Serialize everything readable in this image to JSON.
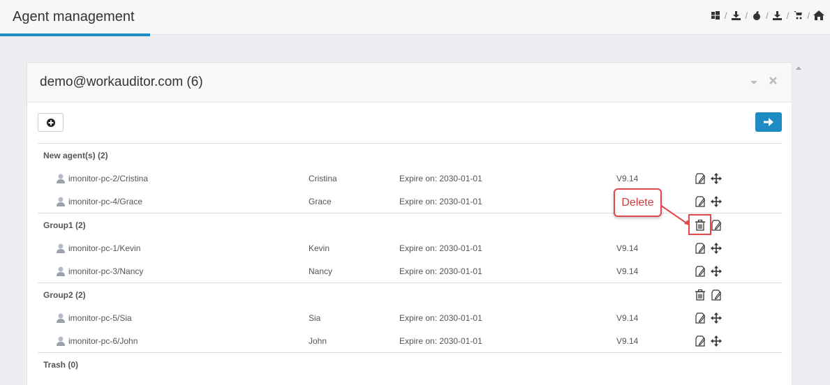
{
  "header": {
    "title": "Agent management",
    "nav": [
      {
        "icon": "windows-icon"
      },
      {
        "icon": "download-icon"
      },
      {
        "icon": "apple-icon"
      },
      {
        "icon": "download-icon"
      },
      {
        "icon": "cart-icon"
      },
      {
        "icon": "home-icon"
      }
    ],
    "separator": "/"
  },
  "panel": {
    "title": "demo@workauditor.com (6)",
    "collapse_icon": "caret-down-icon",
    "close_icon": "close-icon"
  },
  "toolbar": {
    "add_icon": "plus-circle-icon",
    "go_icon": "arrow-right-icon"
  },
  "groups": [
    {
      "label": "New agent(s) (2)",
      "agents": [
        {
          "name": "imonitor-pc-2/Cristina",
          "user": "Cristina",
          "expire": "Expire on: 2030-01-01",
          "version": "V9.14"
        },
        {
          "name": "imonitor-pc-4/Grace",
          "user": "Grace",
          "expire": "Expire on: 2030-01-01",
          "version": ""
        }
      ]
    },
    {
      "label": "Group1 (2)",
      "agents": [
        {
          "name": "imonitor-pc-1/Kevin",
          "user": "Kevin",
          "expire": "Expire on: 2030-01-01",
          "version": "V9.14"
        },
        {
          "name": "imonitor-pc-3/Nancy",
          "user": "Nancy",
          "expire": "Expire on: 2030-01-01",
          "version": "V9.14"
        }
      ]
    },
    {
      "label": "Group2 (2)",
      "agents": [
        {
          "name": "imonitor-pc-5/Sia",
          "user": "Sia",
          "expire": "Expire on: 2030-01-01",
          "version": "V9.14"
        },
        {
          "name": "imonitor-pc-6/John",
          "user": "John",
          "expire": "Expire on: 2030-01-01",
          "version": "V9.14"
        }
      ]
    },
    {
      "label": "Trash (0)",
      "agents": []
    }
  ],
  "annotation": {
    "callout_text": "Delete",
    "color": "#e1484a"
  },
  "colors": {
    "accent": "#1e8bc3"
  }
}
